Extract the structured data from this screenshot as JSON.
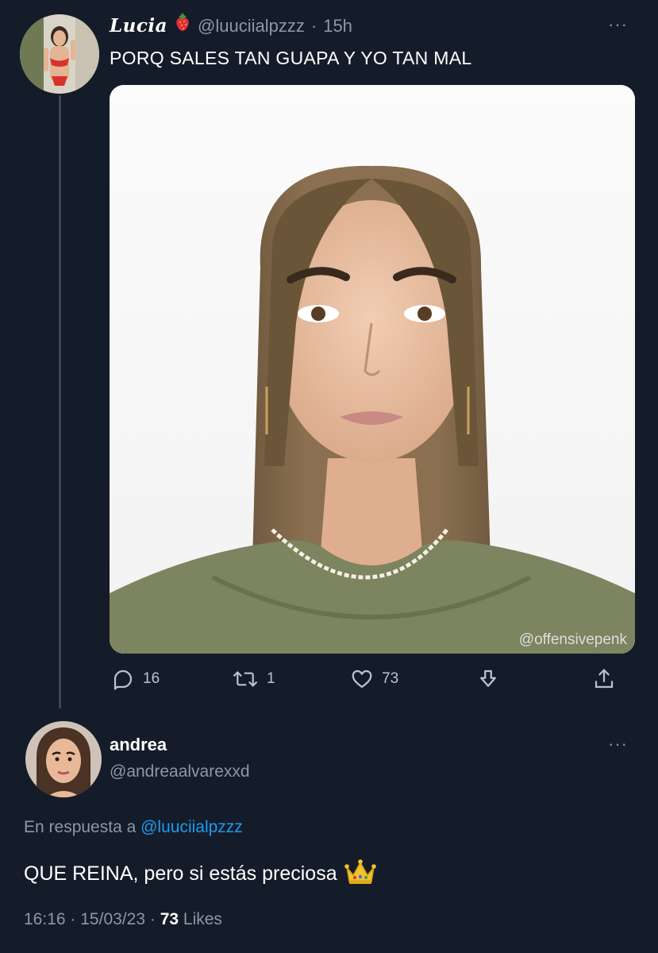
{
  "tweet": {
    "name": "Lucia",
    "handle": "@luuciialpzzz",
    "separator": "·",
    "time": "15h",
    "text": "PORQ SALES TAN GUAPA Y YO TAN MAL",
    "more": "···",
    "image_watermark": "@offensivepenk",
    "actions": {
      "replies": "16",
      "retweets": "1",
      "likes": "73"
    }
  },
  "reply": {
    "name": "andrea",
    "handle": "@andreaalvarexxd",
    "more": "···",
    "in_reply_prefix": "En respuesta a",
    "in_reply_mention": "@luuciialpzzz",
    "text": "QUE REINA, pero si estás preciosa",
    "time": "16:16",
    "separator": "·",
    "date": "15/03/23",
    "separator2": "·",
    "likes_count": "73",
    "likes_label": "Likes"
  },
  "icons": {
    "reply": "reply-icon",
    "retweet": "retweet-icon",
    "like": "heart-icon",
    "bookmark": "bookmark-icon",
    "share": "share-icon"
  },
  "colors": {
    "background": "#141c2a",
    "secondary_text": "#8b98a5",
    "link": "#1d9bf0",
    "thread_line": "#3a4556"
  }
}
